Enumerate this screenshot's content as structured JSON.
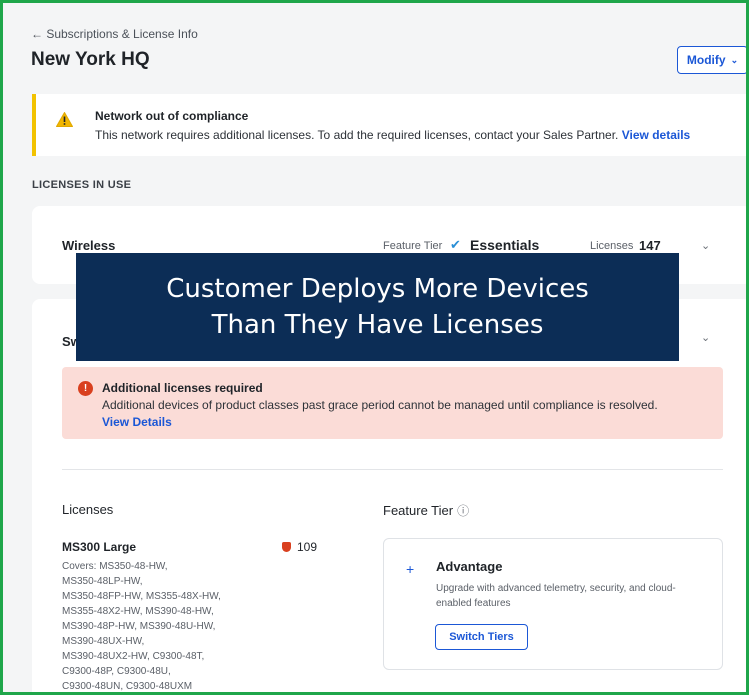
{
  "header": {
    "back_link": "← Subscriptions & License Info",
    "title": "New York HQ",
    "modify_label": "Modify"
  },
  "compliance_banner": {
    "title": "Network out of compliance",
    "body": "This network requires additional licenses. To add the required licenses, contact your Sales Partner.",
    "link": "View details",
    "icon": "warning-triangle-icon",
    "accent_color": "#f2c200"
  },
  "section_label": "LICENSES IN USE",
  "wireless": {
    "name": "Wireless",
    "feature_tier_label": "Feature Tier",
    "tier": "Essentials",
    "licenses_label": "Licenses",
    "licenses_count": "147"
  },
  "switch": {
    "name_visible": "Sw",
    "error_banner": {
      "title": "Additional licenses required",
      "body": "Additional devices of product classes past grace period cannot be managed until compliance is resolved.",
      "link": "View Details",
      "icon": "error-shield-icon",
      "bg_color": "#fbdcd7"
    },
    "licenses_heading": "Licenses",
    "feature_tier_heading": "Feature Tier",
    "license_model": {
      "name": "MS300 Large",
      "count": "109",
      "covers": [
        "Covers: MS350-48-HW,",
        "MS350-48LP-HW,",
        "MS350-48FP-HW, MS355-48X-HW,",
        "MS355-48X2-HW, MS390-48-HW,",
        "MS390-48P-HW, MS390-48U-HW,",
        "MS390-48UX-HW,",
        "MS390-48UX2-HW, C9300-48T,",
        "C9300-48P, C9300-48U,",
        "C9300-48UN, C9300-48UXM"
      ]
    },
    "tier_option": {
      "name": "Advantage",
      "description": "Upgrade with advanced telemetry, security, and cloud-enabled features",
      "button": "Switch Tiers"
    }
  },
  "overlay": {
    "line1": "Customer Deploys More Devices",
    "line2": "Than They Have Licenses",
    "bg_color": "#0c2d56"
  },
  "colors": {
    "frame_border": "#1fa64a",
    "link_blue": "#1b57d6",
    "error_red": "#d9401f"
  }
}
